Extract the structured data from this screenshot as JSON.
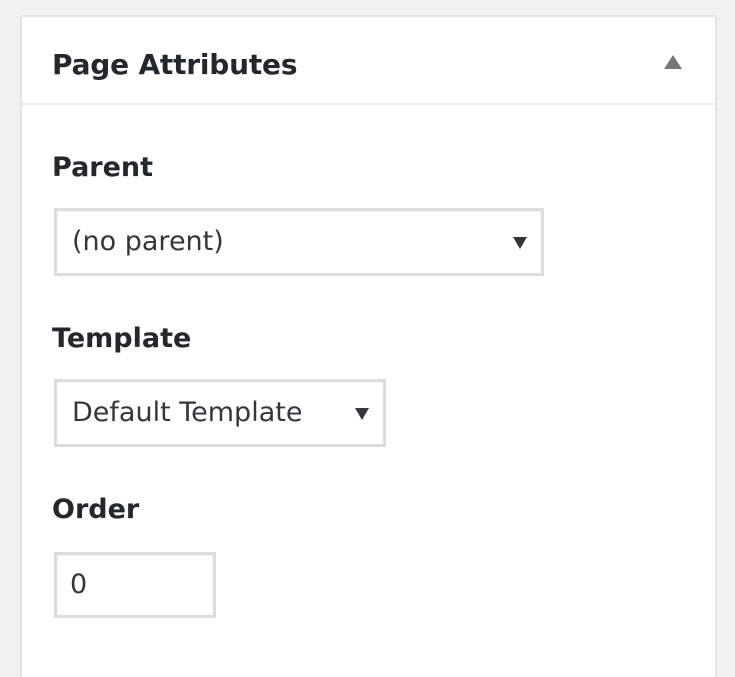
{
  "panel": {
    "title": "Page Attributes",
    "toggle_icon": "triangle-up-icon"
  },
  "fields": {
    "parent": {
      "label": "Parent",
      "selected": "(no parent)",
      "arrow_icon": "triangle-down-icon"
    },
    "template": {
      "label": "Template",
      "selected": "Default Template",
      "arrow_icon": "triangle-down-icon"
    },
    "order": {
      "label": "Order",
      "value": "0"
    }
  },
  "colors": {
    "background": "#f1f1f1",
    "panel": "#ffffff",
    "border": "#dddddd",
    "text": "#23282d",
    "icon": "#72777c"
  }
}
